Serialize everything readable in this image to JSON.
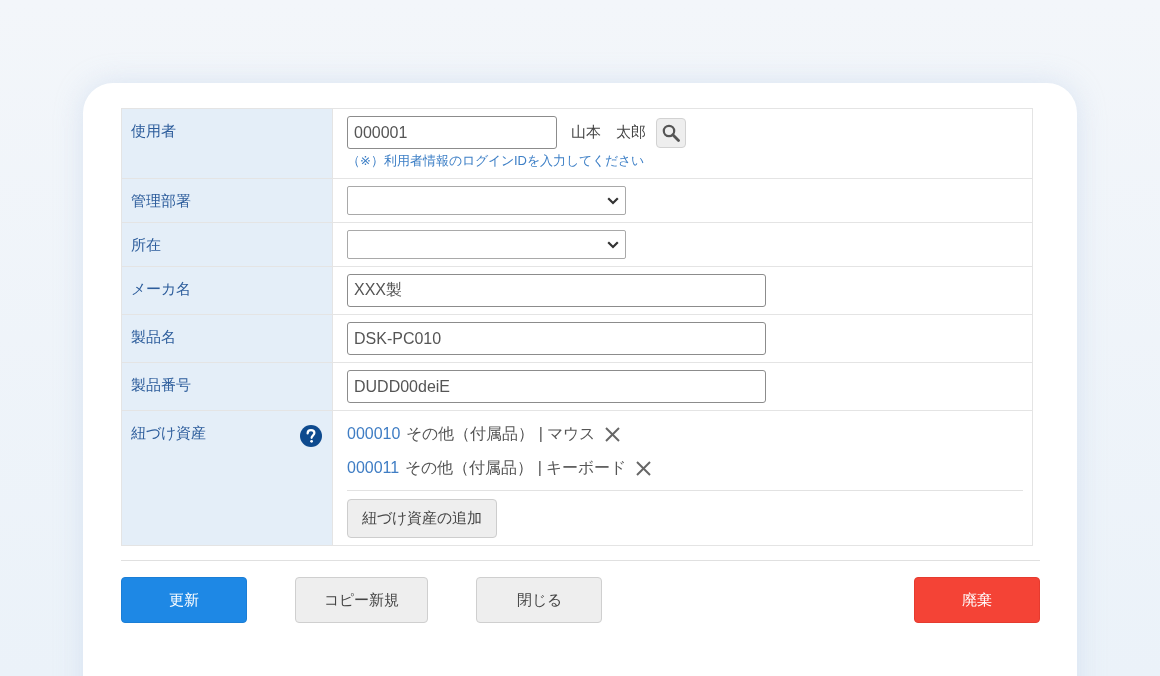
{
  "form": {
    "rows": [
      {
        "kind": "user",
        "label": "使用者",
        "help": false,
        "value": "000001",
        "user_name": "山本　太郎",
        "hint": "（※）利用者情報のログインIDを入力してください"
      },
      {
        "kind": "select",
        "label": "管理部署",
        "help": false
      },
      {
        "kind": "select",
        "label": "所在",
        "help": false
      },
      {
        "kind": "text",
        "label": "メーカ名",
        "help": false,
        "value": "XXX製"
      },
      {
        "kind": "text",
        "label": "製品名",
        "help": false,
        "value": "DSK-PC010"
      },
      {
        "kind": "text",
        "label": "製品番号",
        "help": false,
        "value": "DUDD00deiE"
      },
      {
        "kind": "linked",
        "label": "紐づけ資産",
        "help": true,
        "items": [
          {
            "code": "000010",
            "text": "その他（付属品） | マウス"
          },
          {
            "code": "000011",
            "text": "その他（付属品） | キーボード"
          }
        ],
        "add_button": "紐づけ資産の追加"
      }
    ]
  },
  "buttons": [
    {
      "kind": "primary",
      "label": "更新"
    },
    {
      "kind": "default",
      "label": "コピー新規"
    },
    {
      "kind": "default",
      "label": "閉じる"
    },
    {
      "kind": "danger",
      "label": "廃棄"
    }
  ]
}
